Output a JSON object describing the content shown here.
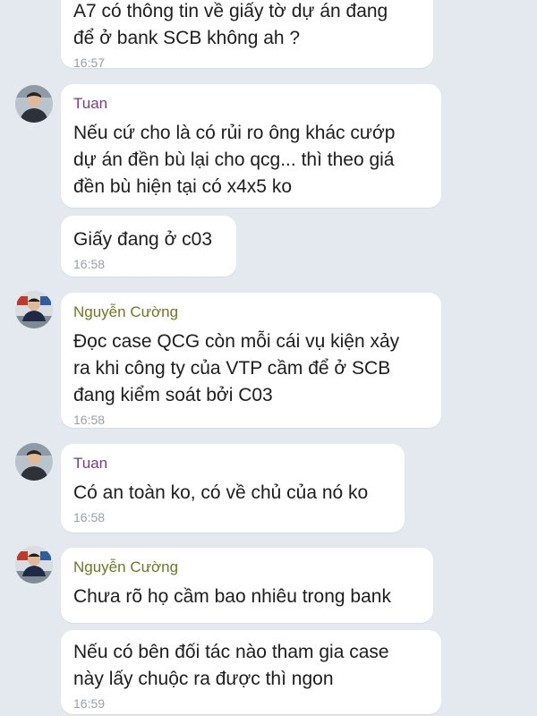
{
  "colors": {
    "background": "#e3e9ef",
    "bubble": "#ffffff",
    "tuan_name": "#7a3b8c",
    "cuong_name": "#6d7a1f",
    "timestamp": "#9aa0a6"
  },
  "messages": [
    {
      "sender": "",
      "text": "A7 có thông tin về giấy tờ dự án đang\nđể ở bank SCB không ah ?",
      "time": "16:57"
    },
    {
      "sender": "Tuan",
      "text": "Nếu cứ cho là có rủi ro ông khác cướp\ndự án đền bù lại cho qcg... thì theo giá\nđền bù hiện tại có x4x5 ko",
      "time": ""
    },
    {
      "sender": "",
      "text": "Giấy đang ở c03",
      "time": "16:58"
    },
    {
      "sender": "Nguyễn Cường",
      "text": "Đọc case QCG còn mỗi cái vụ kiện xảy\nra khi công ty của VTP cầm để ở SCB\nđang kiểm soát bởi C03",
      "time": "16:58"
    },
    {
      "sender": "Tuan",
      "text": "Có an toàn ko, có về chủ của nó ko",
      "time": "16:58"
    },
    {
      "sender": "Nguyễn Cường",
      "text": "Chưa rõ họ cầm bao nhiêu trong bank",
      "time": ""
    },
    {
      "sender": "",
      "text": "Nếu có bên đối tác nào tham gia case\nnày lấy chuộc ra được thì ngon",
      "time": "16:59"
    }
  ]
}
